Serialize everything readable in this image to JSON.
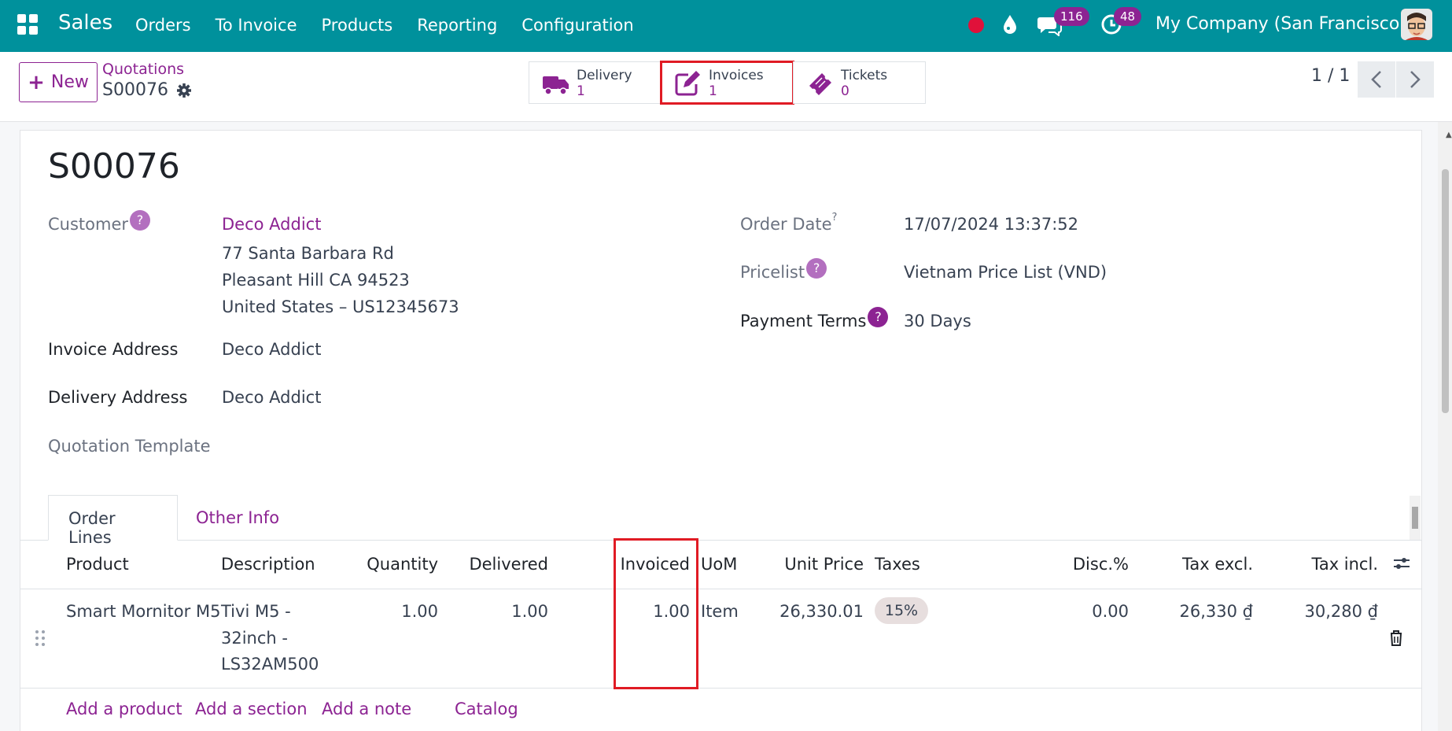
{
  "navbar": {
    "brand": "Sales",
    "menu": [
      "Orders",
      "To Invoice",
      "Products",
      "Reporting",
      "Configuration"
    ],
    "chat_count": "116",
    "activity_count": "48",
    "company": "My Company (San Francisco)",
    "color": "#00919c"
  },
  "control": {
    "new_label": "New",
    "breadcrumb": "Quotations",
    "record": "S00076",
    "smart_buttons": [
      {
        "label": "Delivery",
        "value": "1",
        "icon": "truck-icon"
      },
      {
        "label": "Invoices",
        "value": "1",
        "icon": "pencil-square-icon"
      },
      {
        "label": "Tickets",
        "value": "0",
        "icon": "ticket-icon"
      }
    ],
    "pager": "1 / 1"
  },
  "form": {
    "title": "S00076",
    "customer_label": "Customer",
    "customer_name": "Deco Addict",
    "customer_address": [
      "77 Santa Barbara Rd",
      "Pleasant Hill CA 94523",
      "United States – US12345673"
    ],
    "invoice_address_label": "Invoice Address",
    "invoice_address": "Deco Addict",
    "delivery_address_label": "Delivery Address",
    "delivery_address": "Deco Addict",
    "quotation_template_label": "Quotation Template",
    "order_date_label": "Order Date",
    "order_date": "17/07/2024 13:37:52",
    "pricelist_label": "Pricelist",
    "pricelist": "Vietnam Price List (VND)",
    "payment_terms_label": "Payment Terms",
    "payment_terms": "30 Days",
    "help_mark": "?"
  },
  "tabs": [
    "Order Lines",
    "Other Info"
  ],
  "table": {
    "headers": [
      "Product",
      "Description",
      "Quantity",
      "Delivered",
      "Invoiced",
      "UoM",
      "Unit Price",
      "Taxes",
      "Disc.%",
      "Tax excl.",
      "Tax incl."
    ],
    "rows": [
      {
        "product": "Smart Mornitor M5",
        "description": [
          "Tivi M5 -",
          "32inch -",
          "LS32AM500"
        ],
        "quantity": "1.00",
        "delivered": "1.00",
        "invoiced": "1.00",
        "uom": "Item",
        "unit_price": "26,330.01",
        "taxes": "15%",
        "discount": "0.00",
        "tax_excl": "26,330 ₫",
        "tax_incl": "30,280 ₫"
      }
    ],
    "add_links": [
      "Add a product",
      "Add a section",
      "Add a note",
      "Catalog"
    ]
  },
  "colors": {
    "accent": "#8c2392",
    "highlight": "#e01b24"
  }
}
